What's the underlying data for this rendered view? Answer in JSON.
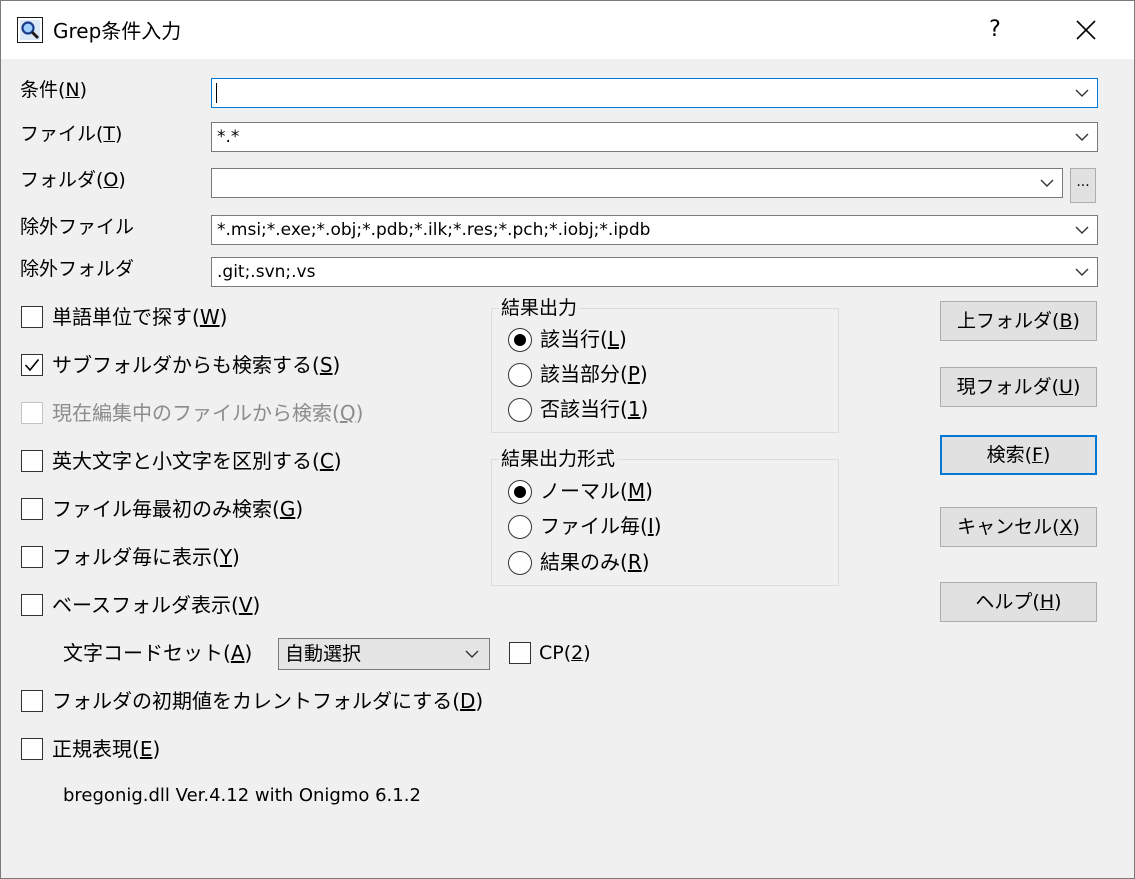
{
  "window": {
    "title": "Grep条件入力",
    "help_glyph": "?",
    "app_icon": "magnifier-icon"
  },
  "fields": {
    "condition": {
      "label_pre": "条件(",
      "mnemonic": "N",
      "label_post": ")",
      "value": ""
    },
    "file": {
      "label_pre": "ファイル(",
      "mnemonic": "T",
      "label_post": ")",
      "value": "*.*"
    },
    "folder": {
      "label_pre": "フォルダ(",
      "mnemonic": "O",
      "label_post": ")",
      "value": "",
      "browse_label": "..."
    },
    "exclude_file": {
      "label": "除外ファイル",
      "value": "*.msi;*.exe;*.obj;*.pdb;*.ilk;*.res;*.pch;*.iobj;*.ipdb"
    },
    "exclude_folder": {
      "label": "除外フォルダ",
      "value": ".git;.svn;.vs"
    }
  },
  "options": [
    {
      "pre": "単語単位で探す(",
      "mn": "W",
      "post": ")",
      "checked": false,
      "disabled": false
    },
    {
      "pre": "サブフォルダからも検索する(",
      "mn": "S",
      "post": ")",
      "checked": true,
      "disabled": false
    },
    {
      "pre": "現在編集中のファイルから検索(",
      "mn": "Q",
      "post": ")",
      "checked": false,
      "disabled": true
    },
    {
      "pre": "英大文字と小文字を区別する(",
      "mn": "C",
      "post": ")",
      "checked": false,
      "disabled": false
    },
    {
      "pre": "ファイル毎最初のみ検索(",
      "mn": "G",
      "post": ")",
      "checked": false,
      "disabled": false
    },
    {
      "pre": "フォルダ毎に表示(",
      "mn": "Y",
      "post": ")",
      "checked": false,
      "disabled": false
    },
    {
      "pre": "ベースフォルダ表示(",
      "mn": "V",
      "post": ")",
      "checked": false,
      "disabled": false
    }
  ],
  "encoding": {
    "label_pre": "文字コードセット(",
    "mnemonic": "A",
    "label_post": ")",
    "selected": "自動選択",
    "cp_pre": "CP(",
    "cp_mnemonic": "2",
    "cp_post": ")",
    "cp_checked": false
  },
  "options2": [
    {
      "pre": "フォルダの初期値をカレントフォルダにする(",
      "mn": "D",
      "post": ")",
      "checked": false
    },
    {
      "pre": "正規表現(",
      "mn": "E",
      "post": ")",
      "checked": false
    }
  ],
  "result_output": {
    "title": "結果出力",
    "options": [
      {
        "pre": "該当行(",
        "mn": "L",
        "post": ")",
        "selected": true
      },
      {
        "pre": "該当部分(",
        "mn": "P",
        "post": ")",
        "selected": false
      },
      {
        "pre": "否該当行(",
        "mn": "1",
        "post": ")",
        "selected": false
      }
    ]
  },
  "result_format": {
    "title": "結果出力形式",
    "options": [
      {
        "pre": "ノーマル(",
        "mn": "M",
        "post": ")",
        "selected": true
      },
      {
        "pre": "ファイル毎(",
        "mn": "I",
        "post": ")",
        "selected": false
      },
      {
        "pre": "結果のみ(",
        "mn": "R",
        "post": ")",
        "selected": false
      }
    ]
  },
  "buttons": [
    {
      "pre": "上フォルダ(",
      "mn": "B",
      "post": ")"
    },
    {
      "pre": "現フォルダ(",
      "mn": "U",
      "post": ")"
    },
    {
      "pre": "検索(",
      "mn": "F",
      "post": ")",
      "default": true
    },
    {
      "pre": "キャンセル(",
      "mn": "X",
      "post": ")"
    },
    {
      "pre": "ヘルプ(",
      "mn": "H",
      "post": ")"
    }
  ],
  "version_text": "bregonig.dll Ver.4.12 with Onigmo 6.1.2"
}
